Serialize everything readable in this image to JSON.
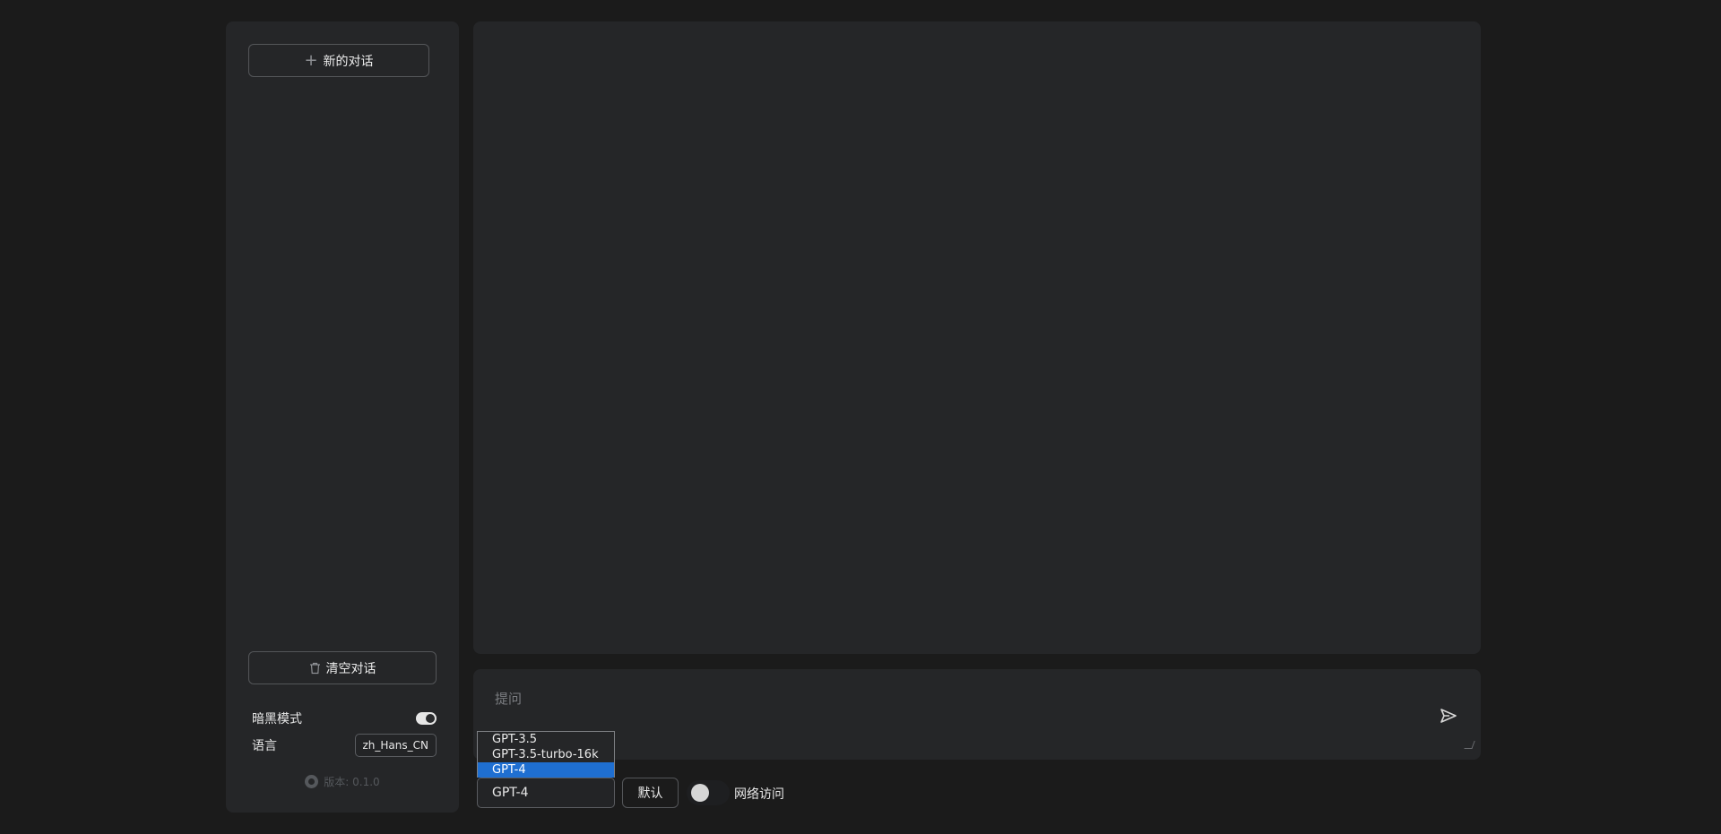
{
  "sidebar": {
    "new_chat_label": "新的对话",
    "new_chat_icon": "plus-icon",
    "clear_chat_label": "清空对话",
    "clear_chat_icon": "trash-icon",
    "dark_mode_label": "暗黑模式",
    "dark_mode_on": true,
    "language_label": "语言",
    "language_value": "zh_Hans_CN",
    "version_text": "版本: 0.1.0",
    "version_icon": "github-icon"
  },
  "composer": {
    "placeholder": "提问",
    "send_icon": "send-icon"
  },
  "model": {
    "options": [
      "GPT-3.5",
      "GPT-3.5-turbo-16k",
      "GPT-4"
    ],
    "highlighted_option": "GPT-4",
    "selected": "GPT-4"
  },
  "controls": {
    "default_button_label": "默认",
    "network_toggle_on": false,
    "network_label": "网络访问"
  },
  "colors": {
    "background": "#1b1b1b",
    "panel": "#252628",
    "highlight": "#1f6fd1"
  }
}
